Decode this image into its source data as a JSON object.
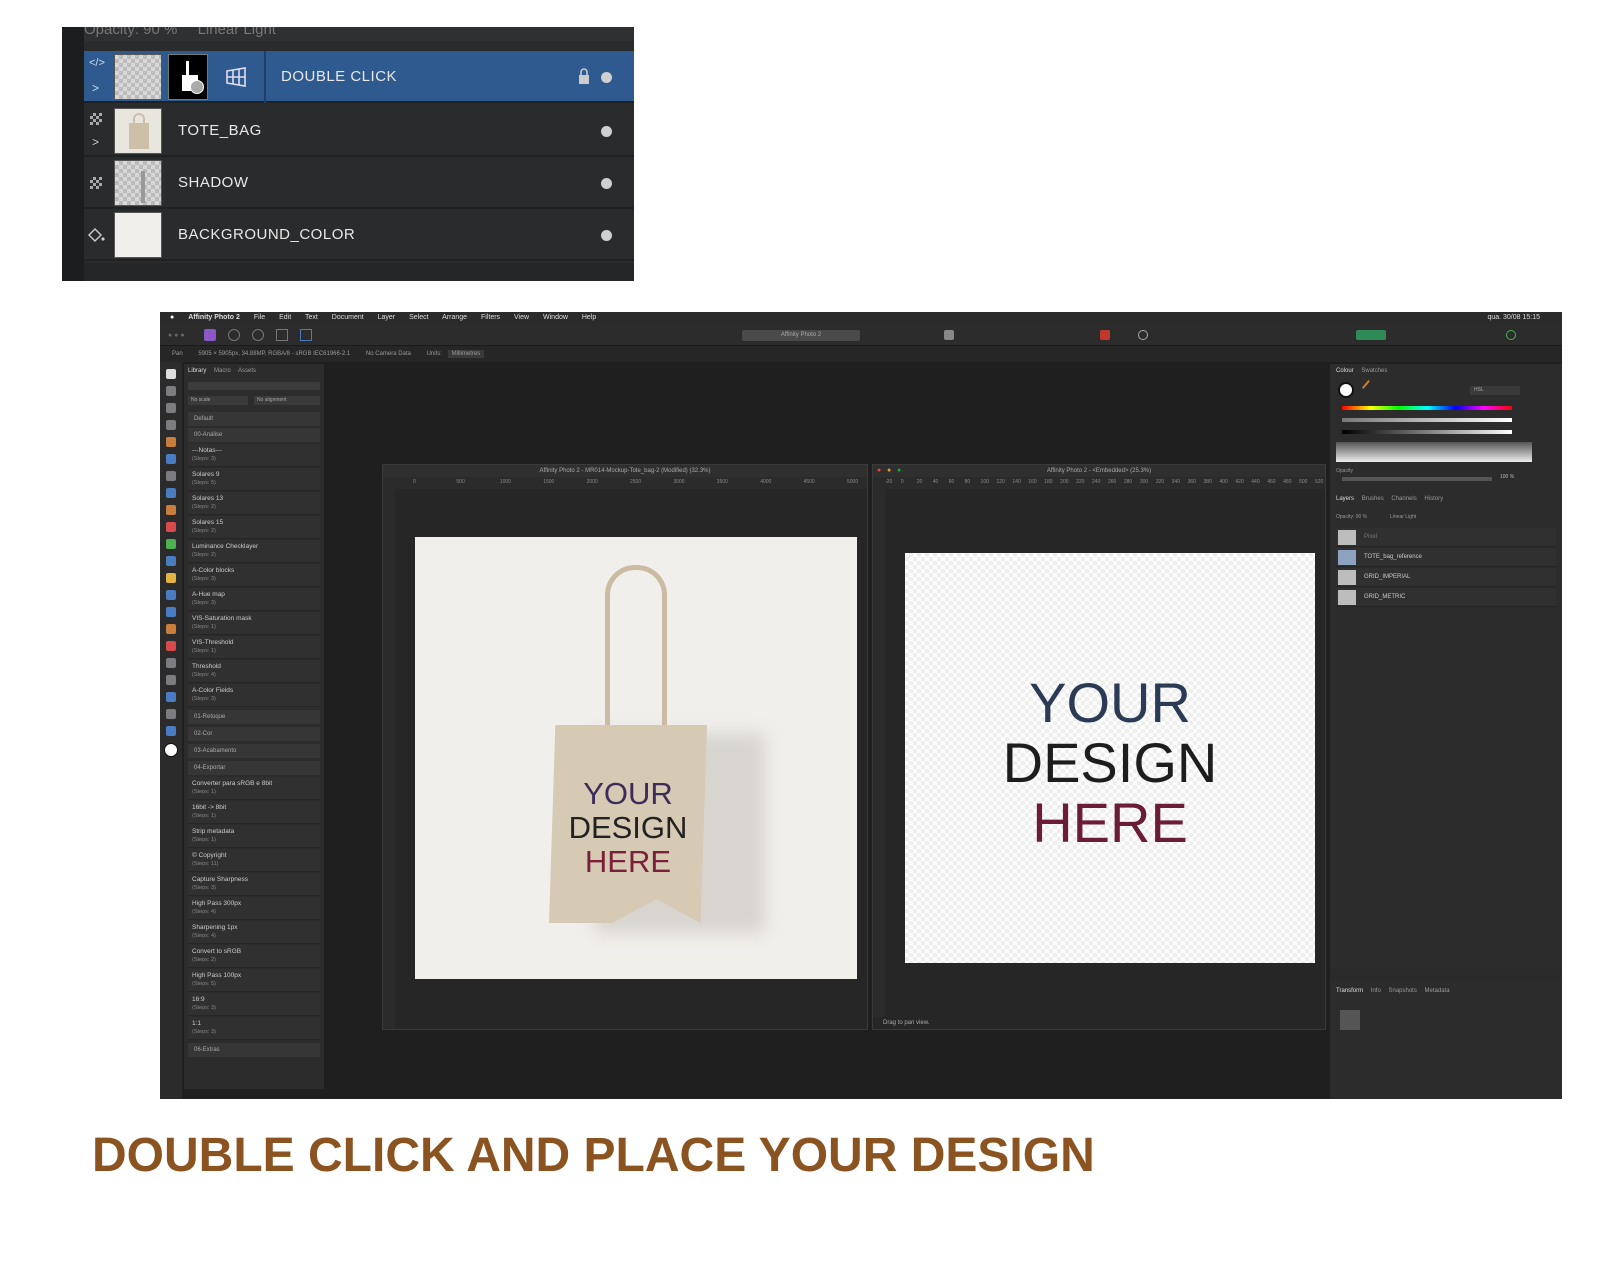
{
  "zoom_panel": {
    "opacity_text": "Opacity: 90 %",
    "blend_text": "Linear Light",
    "layers": [
      {
        "name": "DOUBLE CLICK",
        "selected": true,
        "locked": true
      },
      {
        "name": "TOTE_BAG",
        "selected": false
      },
      {
        "name": "SHADOW",
        "selected": false
      },
      {
        "name": "BACKGROUND_COLOR",
        "selected": false
      }
    ]
  },
  "app": {
    "name": "Affinity Photo 2",
    "menu": [
      "File",
      "Edit",
      "Text",
      "Document",
      "Layer",
      "Select",
      "Arrange",
      "Filters",
      "View",
      "Window",
      "Help"
    ],
    "clock": "qua. 30/08  15:15",
    "toolbar_title": "Affinity Photo 2",
    "context": {
      "tool": "Pan",
      "doc_info": "5905 × 5905px, 34.88MP, RGBA/8 - sRGB IEC61966-2.1",
      "camera": "No Camera Data",
      "units_label": "Units:",
      "units_value": "Millimetres"
    },
    "left_panel": {
      "tabs": [
        "Library",
        "Macro",
        "Assets"
      ],
      "scale": "No scale",
      "alignment": "No alignment",
      "groups": [
        "Default",
        "00-Análise",
        "01-Retoque",
        "02-Cor",
        "03-Acabamento",
        "04-Exportar",
        "06-Extras"
      ],
      "items_analysis": [
        {
          "name": "---Notas---",
          "steps": "(Steps: 3)"
        },
        {
          "name": "Solares 9",
          "steps": "(Steps: 5)"
        },
        {
          "name": "Solares 13",
          "steps": "(Steps: 2)"
        },
        {
          "name": "Solares 15",
          "steps": "(Steps: 2)"
        },
        {
          "name": "Luminance Checklayer",
          "steps": "(Steps: 2)"
        },
        {
          "name": "A-Color blocks",
          "steps": "(Steps: 3)"
        },
        {
          "name": "A-Hue map",
          "steps": "(Steps: 3)"
        },
        {
          "name": "VIS-Saturation mask",
          "steps": "(Steps: 1)"
        },
        {
          "name": "VIS-Threshold",
          "steps": "(Steps: 1)"
        },
        {
          "name": "Threshold",
          "steps": "(Steps: 4)"
        },
        {
          "name": "A-Color Fields",
          "steps": "(Steps: 3)"
        }
      ],
      "items_export": [
        {
          "name": "Converter para sRGB e 8bit",
          "steps": "(Steps: 1)"
        },
        {
          "name": "16bit -> 8bit",
          "steps": "(Steps: 1)"
        },
        {
          "name": "Strip metadata",
          "steps": "(Steps: 1)"
        },
        {
          "name": "© Copyright",
          "steps": "(Steps: 11)"
        },
        {
          "name": "Capture Sharpness",
          "steps": "(Steps: 3)"
        },
        {
          "name": "High Pass 300px",
          "steps": "(Steps: 4)"
        },
        {
          "name": "Sharpening 1px",
          "steps": "(Steps: 4)"
        },
        {
          "name": "Convert to sRGB",
          "steps": "(Steps: 2)"
        },
        {
          "name": "High Pass 100px",
          "steps": "(Steps: 5)"
        },
        {
          "name": "16:9",
          "steps": "(Steps: 3)"
        },
        {
          "name": "1:1",
          "steps": "(Steps: 3)"
        }
      ]
    },
    "doc_left": {
      "title": "Affinity Photo 2 - MR014-Mockup-Tote_bag-2 (Modified) (32.3%)",
      "ruler_ticks": [
        "0",
        "500",
        "1000",
        "1500",
        "2000",
        "2500",
        "3000",
        "3500",
        "4000",
        "4500",
        "5000"
      ]
    },
    "doc_right": {
      "title": "Affinity Photo 2 - <Embedded> (25.3%)",
      "status": "Drag to pan view.",
      "ruler_ticks": [
        "-20",
        "0",
        "20",
        "40",
        "60",
        "80",
        "100",
        "120",
        "140",
        "160",
        "180",
        "200",
        "220",
        "240",
        "260",
        "280",
        "300",
        "320",
        "340",
        "360",
        "380",
        "400",
        "420",
        "440",
        "460",
        "480",
        "500",
        "520"
      ]
    },
    "design_text": [
      "YOUR",
      "DESIGN",
      "HERE"
    ],
    "right_panel": {
      "colour_tabs": [
        "Colour",
        "Swatches"
      ],
      "model": "HSL",
      "opacity_label": "Opacity",
      "opacity_value": "100 %",
      "layer_tabs": [
        "Layers",
        "Brushes",
        "Channels",
        "History"
      ],
      "layer_opacity": "Opacity: 90 %",
      "layer_blend": "Linear Light",
      "layers": [
        "Pixel",
        "TOTE_bag_reference",
        "GRID_IMPERIAL",
        "GRID_METRIC"
      ],
      "bottom_tabs": [
        "Transform",
        "Info",
        "Snapshots",
        "Metadata"
      ]
    }
  },
  "caption": "DOUBLE CLICK AND PLACE YOUR DESIGN",
  "colors": {
    "caption": "#8a5320",
    "selected_layer": "#2f5a90",
    "app_bg": "#1f1f20"
  }
}
